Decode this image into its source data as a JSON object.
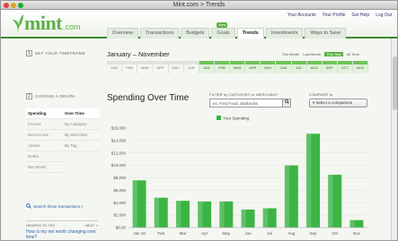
{
  "window": {
    "title": "Mint.com > Trends"
  },
  "logo": {
    "text": "mint",
    "suffix": ".com"
  },
  "toplinks": [
    "Your Accounts",
    "Your Profile",
    "Get Help",
    "Log Out"
  ],
  "nav": {
    "tabs": [
      {
        "label": "Overview"
      },
      {
        "label": "Transactions"
      },
      {
        "label": "Budgets"
      },
      {
        "label": "Goals",
        "badge": "New"
      },
      {
        "label": "Trends",
        "active": true
      },
      {
        "label": "Investments"
      },
      {
        "label": "Ways to Save"
      }
    ]
  },
  "timeframe": {
    "heading": "SET YOUR TIMEFRAME",
    "number": "1",
    "range_title": "January – November",
    "options": [
      "This Month",
      "Last Month",
      "This Year",
      "All Time"
    ],
    "selected_option": "This Year",
    "months_prev": [
      "JAN",
      "FEB",
      "MAR",
      "APR",
      "MAY",
      "JUN",
      "JUL",
      "AUG",
      "SEP",
      "OCT",
      "NOV",
      "DEC"
    ],
    "months_curr": [
      "JAN",
      "FEB",
      "MAR",
      "APR",
      "MAY",
      "JUN",
      "JUL",
      "AUG",
      "SEP",
      "OCT",
      "NOV"
    ]
  },
  "graph": {
    "heading": "CHOOSE A GRAPH",
    "number": "2",
    "left_items": [
      "Spending",
      "Income",
      "Net Income",
      "Assets",
      "Debts",
      "Net Worth"
    ],
    "right_items": [
      "Over Time",
      "By Category",
      "By Merchant",
      "By Tag"
    ],
    "selected_left": "Spending",
    "selected_right": "Over Time"
  },
  "search_transactions": "Search these transactions »",
  "graphs_to_try": {
    "label": "GRAPHS TO TRY",
    "next": "NEXT »",
    "link": "How is my net worth changing over time?"
  },
  "filter": {
    "label": "FILTER by CATEGORY or MERCHANT",
    "placeholder": "ex: Fast Food, Starbucks"
  },
  "compare": {
    "label": "COMPARE to",
    "button": "Select a comparison"
  },
  "chart_data": {
    "type": "bar",
    "title": "Spending Over Time",
    "legend": "Your Spending",
    "categories": [
      "Jan 10",
      "Feb",
      "Mar",
      "Apr",
      "May",
      "Jun",
      "Jul",
      "Aug",
      "Sep",
      "Oct",
      "Nov"
    ],
    "values": [
      7600,
      4800,
      4300,
      4200,
      4200,
      2900,
      3100,
      10000,
      15100,
      8500,
      1200
    ],
    "ylim": [
      0,
      16000
    ],
    "yticks": [
      "$0.00",
      "$2,000",
      "$4,000",
      "$6,000",
      "$8,000",
      "$10,000",
      "$12,000",
      "$14,000",
      "$16,000"
    ],
    "ytick_values": [
      0,
      2000,
      4000,
      6000,
      8000,
      10000,
      12000,
      14000,
      16000
    ],
    "bar_color": "#3cb444"
  }
}
